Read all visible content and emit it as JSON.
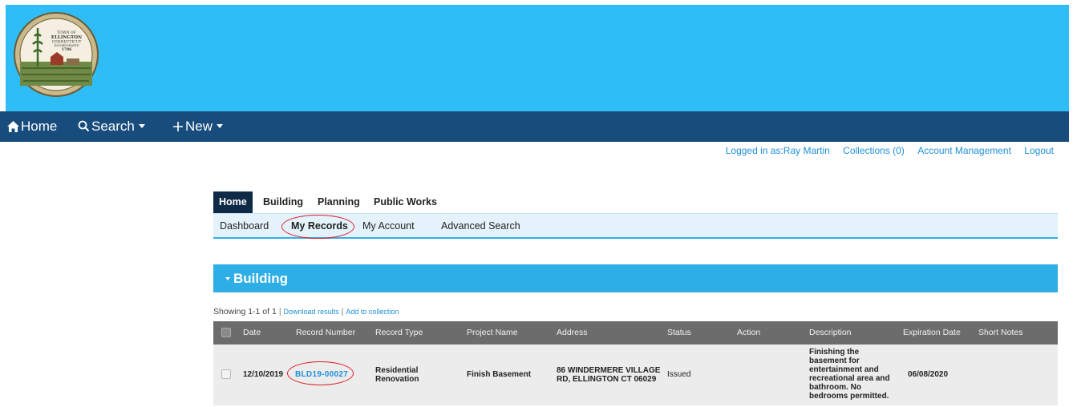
{
  "colors": {
    "banner": "#2ebdf7",
    "nav": "#174c7c",
    "accent": "#2eaee6",
    "link": "#1e90d8",
    "annotation": "#e0202a"
  },
  "seal": {
    "lines": [
      "TOWN OF",
      "ELLINGTON",
      "CONNECTICUT",
      "INCORPORATED",
      "1786"
    ]
  },
  "topnav": {
    "home": "Home",
    "search": "Search",
    "new": "New",
    "home_icon": "house-icon",
    "search_icon": "magnifier-icon",
    "new_icon": "plus-icon"
  },
  "userbar": {
    "logged_in": "Logged in as:Ray Martin",
    "collections": "Collections (0)",
    "account": "Account Management",
    "logout": "Logout"
  },
  "main_tabs": [
    "Home",
    "Building",
    "Planning",
    "Public Works"
  ],
  "sub_tabs": [
    "Dashboard",
    "My Records",
    "My Account",
    "Advanced Search"
  ],
  "section": {
    "title": "Building"
  },
  "results": {
    "showing": "Showing 1-1 of 1",
    "download": "Download results",
    "add": "Add to collection"
  },
  "table": {
    "headers": [
      "Date",
      "Record Number",
      "Record Type",
      "Project Name",
      "Address",
      "Status",
      "Action",
      "Description",
      "Expiration Date",
      "Short Notes"
    ],
    "rows": [
      {
        "date": "12/10/2019",
        "record_number": "BLD19-00027",
        "record_type": [
          "Residential",
          "Renovation"
        ],
        "project_name": "Finish Basement",
        "address": [
          "86 WINDERMERE VILLAGE",
          "RD, ELLINGTON CT 06029"
        ],
        "status": "Issued",
        "action": "",
        "description": [
          "Finishing the",
          "basement for",
          "entertainment and",
          "recreational area and",
          "bathroom. No",
          "bedrooms permitted."
        ],
        "expiration_date": "06/08/2020",
        "short_notes": ""
      }
    ]
  }
}
